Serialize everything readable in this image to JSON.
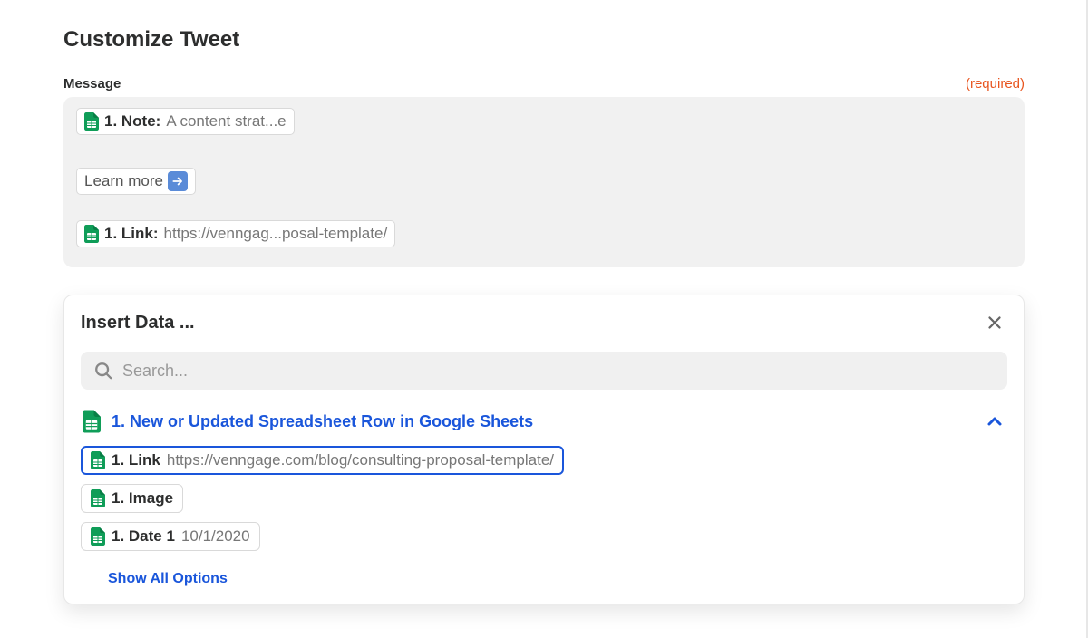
{
  "title": "Customize Tweet",
  "field": {
    "label": "Message",
    "required_text": "(required)"
  },
  "message_pills": {
    "note": {
      "prefix": "1. Note: ",
      "value": "A content strat...e"
    },
    "learn_more": "Learn more",
    "link": {
      "prefix": "1. Link: ",
      "value": "https://venngag...posal-template/"
    }
  },
  "panel": {
    "title": "Insert Data ...",
    "search_placeholder": "Search...",
    "source_title": "1. New or Updated Spreadsheet Row in Google Sheets",
    "items": {
      "link": {
        "label": "1. Link",
        "value": "https://venngage.com/blog/consulting-proposal-template/"
      },
      "image": {
        "label": "1. Image",
        "value": ""
      },
      "date": {
        "label": "1. Date 1",
        "value": "10/1/2020"
      }
    },
    "show_all": "Show All Options"
  }
}
